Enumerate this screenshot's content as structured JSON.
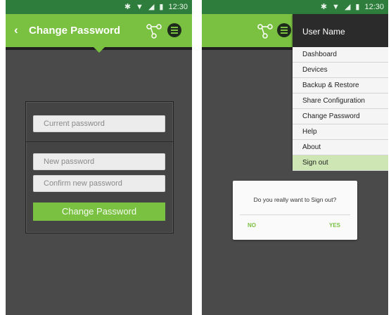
{
  "colors": {
    "accent": "#7ac142",
    "status_bar": "#2f7d3c",
    "background": "#4a4a4a",
    "selected_item": "#cde6b3"
  },
  "status_bar": {
    "time": "12:30",
    "icons": [
      "bluetooth-icon",
      "wifi-icon",
      "signal-icon",
      "battery-icon"
    ]
  },
  "left_screen": {
    "appbar": {
      "back_glyph": "‹",
      "title": "Change Password",
      "icons": [
        "share-icon",
        "menu-icon"
      ]
    },
    "form": {
      "current_password_placeholder": "Current password",
      "new_password_placeholder": "New password",
      "confirm_password_placeholder": "Confirm new password",
      "submit_label": "Change Password"
    }
  },
  "right_screen": {
    "drawer": {
      "user_name": "User Name",
      "items": [
        "Dashboard",
        "Devices",
        "Backup & Restore",
        "Share Configuration",
        "Change Password",
        "Help",
        "About",
        "Sign out"
      ],
      "selected": "Sign out"
    },
    "dialog": {
      "message": "Do you really want to Sign out?",
      "no_label": "NO",
      "yes_label": "YES"
    }
  }
}
